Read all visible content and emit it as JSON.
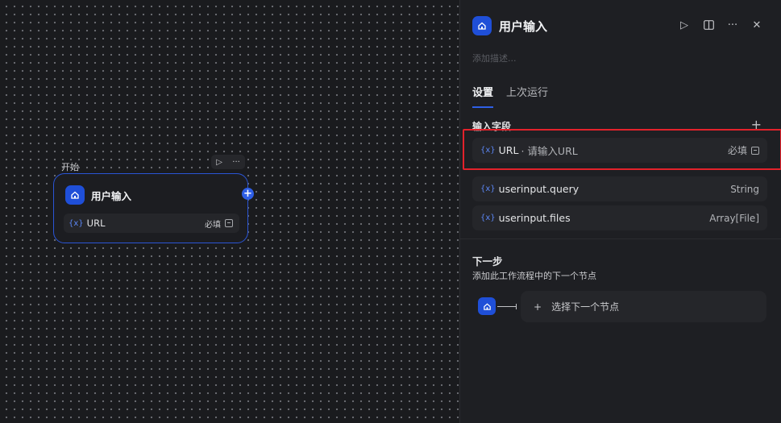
{
  "canvas": {
    "node_label": "开始",
    "node": {
      "title": "用户输入",
      "field": {
        "var_icon": "{x}",
        "name": "URL",
        "required": "必填"
      }
    }
  },
  "panel": {
    "title": "用户输入",
    "description_placeholder": "添加描述...",
    "tabs": [
      {
        "label": "设置",
        "active": true
      },
      {
        "label": "上次运行",
        "active": false
      }
    ],
    "input_section": {
      "title": "输入字段",
      "fields": [
        {
          "var_icon": "{x}",
          "name": "URL",
          "placeholder": "· 请输入URL",
          "type": "必填"
        },
        {
          "var_icon": "{x}",
          "name": "userinput.query",
          "placeholder": "",
          "type": "String"
        },
        {
          "var_icon": "{x}",
          "name": "userinput.files",
          "placeholder": "",
          "type": "Array[File]"
        }
      ]
    },
    "next_step": {
      "title": "下一步",
      "description": "添加此工作流程中的下一个节点",
      "select_label": "选择下一个节点"
    }
  },
  "colors": {
    "accent": "#2f5fe6",
    "highlight": "#e3222b",
    "panel_bg": "#1e1f23"
  }
}
